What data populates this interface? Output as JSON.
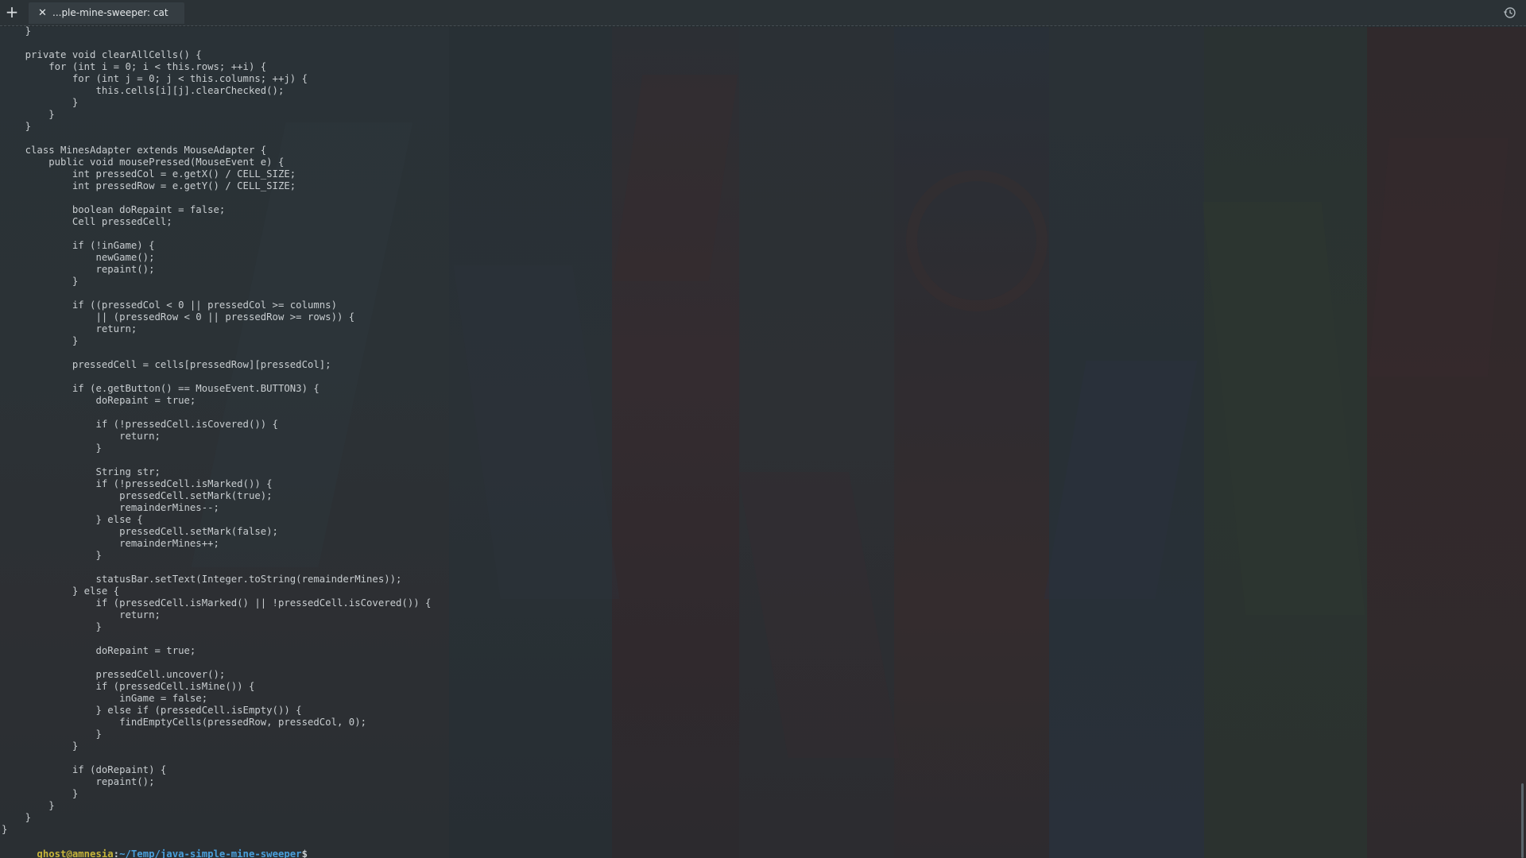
{
  "tabbar": {
    "new_tab_icon": "+",
    "tabs": [
      {
        "close_icon": "✕",
        "title": "...ple-mine-sweeper: cat"
      }
    ],
    "history_icon": "history-icon"
  },
  "terminal": {
    "lines": [
      "    }",
      "",
      "    private void clearAllCells() {",
      "        for (int i = 0; i < this.rows; ++i) {",
      "            for (int j = 0; j < this.columns; ++j) {",
      "                this.cells[i][j].clearChecked();",
      "            }",
      "        }",
      "    }",
      "",
      "    class MinesAdapter extends MouseAdapter {",
      "        public void mousePressed(MouseEvent e) {",
      "            int pressedCol = e.getX() / CELL_SIZE;",
      "            int pressedRow = e.getY() / CELL_SIZE;",
      "",
      "            boolean doRepaint = false;",
      "            Cell pressedCell;",
      "",
      "            if (!inGame) {",
      "                newGame();",
      "                repaint();",
      "            }",
      "",
      "            if ((pressedCol < 0 || pressedCol >= columns)",
      "                || (pressedRow < 0 || pressedRow >= rows)) {",
      "                return;",
      "            }",
      "",
      "            pressedCell = cells[pressedRow][pressedCol];",
      "",
      "            if (e.getButton() == MouseEvent.BUTTON3) {",
      "                doRepaint = true;",
      "",
      "                if (!pressedCell.isCovered()) {",
      "                    return;",
      "                }",
      "",
      "                String str;",
      "                if (!pressedCell.isMarked()) {",
      "                    pressedCell.setMark(true);",
      "                    remainderMines--;",
      "                } else {",
      "                    pressedCell.setMark(false);",
      "                    remainderMines++;",
      "                }",
      "",
      "                statusBar.setText(Integer.toString(remainderMines));",
      "            } else {",
      "                if (pressedCell.isMarked() || !pressedCell.isCovered()) {",
      "                    return;",
      "                }",
      "",
      "                doRepaint = true;",
      "",
      "                pressedCell.uncover();",
      "                if (pressedCell.isMine()) {",
      "                    inGame = false;",
      "                } else if (pressedCell.isEmpty()) {",
      "                    findEmptyCells(pressedRow, pressedCol, 0);",
      "                }",
      "            }",
      "",
      "            if (doRepaint) {",
      "                repaint();",
      "            }",
      "        }",
      "    }",
      "}"
    ],
    "prompt": {
      "user_host": "ghost@amnesia",
      "separator": ":",
      "path": "~/Temp/java-simple-mine-sweeper",
      "symbol": "$"
    }
  },
  "scrollbar": {
    "position": 1.0,
    "visible_fraction": 0.09
  },
  "colors": {
    "prompt_user": "#c7b43a",
    "prompt_path": "#4a9fdc",
    "text": "#c8cdd0",
    "background": "#252c30"
  }
}
